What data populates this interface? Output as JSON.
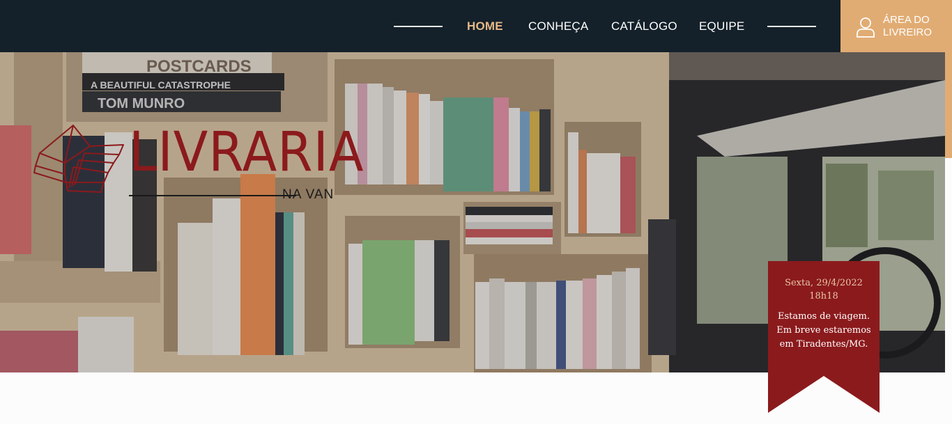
{
  "nav": {
    "items": [
      {
        "label": "HOME",
        "active": true
      },
      {
        "label": "CONHEÇA",
        "active": false
      },
      {
        "label": "CATÁLOGO",
        "active": false
      },
      {
        "label": "EQUIPE",
        "active": false
      }
    ],
    "login_label": "ÁREA DO LIVREIRO",
    "login_icon": "user-icon"
  },
  "logo": {
    "title": "LIVRARIA",
    "subtitle": "NA VAN",
    "icon": "open-book-icon"
  },
  "hero": {
    "background": "bookshelf-in-van-photo",
    "book_texts": [
      "POSTCARDS",
      "A BEAUTIFUL CATASTROPHE",
      "TOM MUNRO"
    ]
  },
  "notice": {
    "date": "Sexta, 29/4/2022",
    "time": "18h18",
    "message_lines": [
      "Estamos de viagem.",
      "Em breve estaremos",
      "em Tiradentes/MG."
    ]
  },
  "colors": {
    "header_bg": "#14212a",
    "accent_gold": "#e1ac73",
    "brand_red": "#8b1a1c"
  }
}
